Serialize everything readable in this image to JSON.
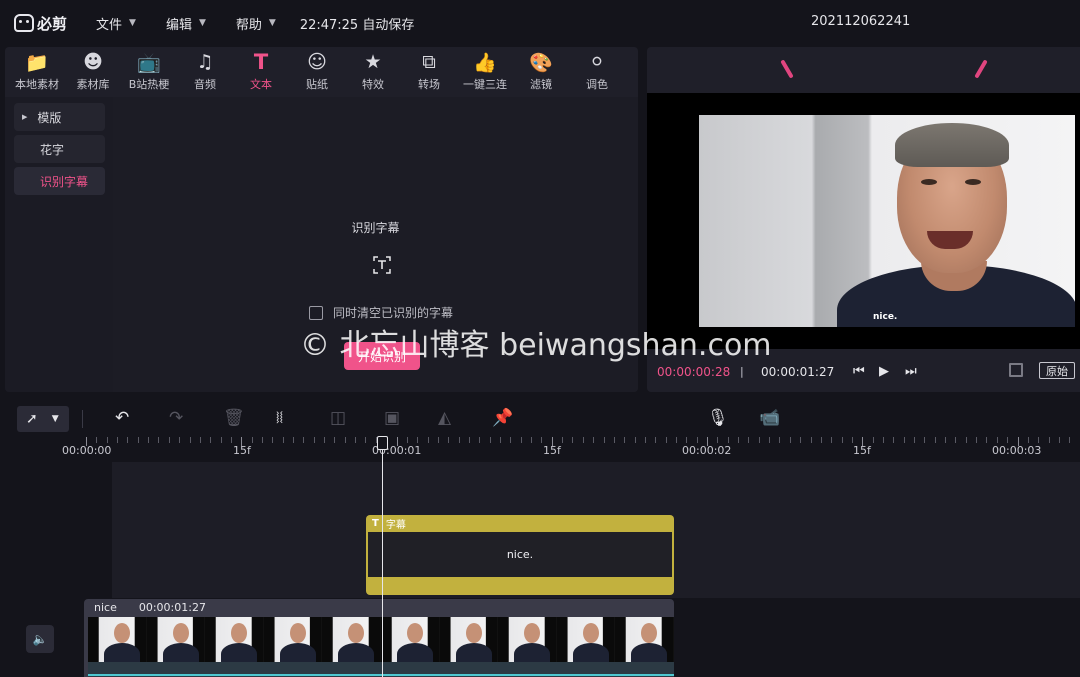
{
  "app": {
    "logo_text": "必剪"
  },
  "menu": [
    {
      "label": "文件"
    },
    {
      "label": "编辑"
    },
    {
      "label": "帮助"
    }
  ],
  "autosave": "22:47:25 自动保存",
  "project_name": "202112062241",
  "media_tabs": [
    {
      "label": "本地素材",
      "icon": "upload-folder-icon"
    },
    {
      "label": "素材库",
      "icon": "robot-face-icon"
    },
    {
      "label": "B站热梗",
      "icon": "tv-icon"
    },
    {
      "label": "音频",
      "icon": "music-note-icon"
    },
    {
      "label": "文本",
      "icon": "text-t-icon",
      "active": true
    },
    {
      "label": "贴纸",
      "icon": "sticker-face-icon"
    },
    {
      "label": "特效",
      "icon": "star-sparkle-icon"
    },
    {
      "label": "转场",
      "icon": "transition-bars-icon"
    },
    {
      "label": "一键三连",
      "icon": "thumbs-up-icon"
    },
    {
      "label": "滤镜",
      "icon": "palette-icon"
    },
    {
      "label": "调色",
      "icon": "color-circles-icon"
    }
  ],
  "sidebar": {
    "items": [
      {
        "label": "模版",
        "expandable": true
      },
      {
        "label": "花字"
      },
      {
        "label": "识别字幕",
        "active": true
      }
    ]
  },
  "recognize": {
    "title": "识别字幕",
    "checkbox_label": "同时清空已识别的字幕",
    "button": "开始识别"
  },
  "preview": {
    "caption": "nice.",
    "current_time": "00:00:00:28",
    "separator": "|",
    "total_time": "00:00:01:27",
    "original_button": "原始"
  },
  "ruler": {
    "labels": [
      "00:00:00",
      "15f",
      "00:00:01",
      "15f",
      "00:00:02",
      "15f",
      "00:00:03"
    ]
  },
  "subtitle_clip": {
    "label": "字幕",
    "text": "nice."
  },
  "video_clip": {
    "name": "nice",
    "duration": "00:00:01:27"
  },
  "watermark": "© 北忘山博客 beiwangshan.com",
  "colors": {
    "accent": "#f0538a",
    "subtitle_track": "#c2b13e",
    "background": "#14141b"
  }
}
